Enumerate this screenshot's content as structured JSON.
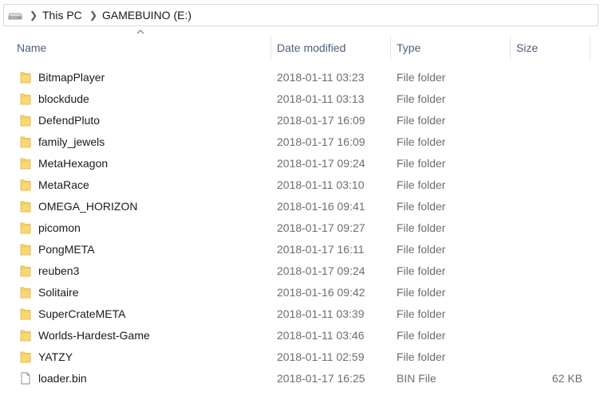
{
  "breadcrumb": {
    "items": [
      "This PC",
      "GAMEBUINO (E:)"
    ]
  },
  "columns": {
    "name": "Name",
    "date": "Date modified",
    "type": "Type",
    "size": "Size"
  },
  "files": [
    {
      "name": "BitmapPlayer",
      "date": "2018-01-11 03:23",
      "type": "File folder",
      "size": "",
      "icon": "folder-icon"
    },
    {
      "name": "blockdude",
      "date": "2018-01-11 03:13",
      "type": "File folder",
      "size": "",
      "icon": "folder-icon"
    },
    {
      "name": "DefendPluto",
      "date": "2018-01-17 16:09",
      "type": "File folder",
      "size": "",
      "icon": "folder-icon"
    },
    {
      "name": "family_jewels",
      "date": "2018-01-17 16:09",
      "type": "File folder",
      "size": "",
      "icon": "folder-icon"
    },
    {
      "name": "MetaHexagon",
      "date": "2018-01-17 09:24",
      "type": "File folder",
      "size": "",
      "icon": "folder-icon"
    },
    {
      "name": "MetaRace",
      "date": "2018-01-11 03:10",
      "type": "File folder",
      "size": "",
      "icon": "folder-icon"
    },
    {
      "name": "OMEGA_HORIZON",
      "date": "2018-01-16 09:41",
      "type": "File folder",
      "size": "",
      "icon": "folder-icon"
    },
    {
      "name": "picomon",
      "date": "2018-01-17 09:27",
      "type": "File folder",
      "size": "",
      "icon": "folder-icon"
    },
    {
      "name": "PongMETA",
      "date": "2018-01-17 16:11",
      "type": "File folder",
      "size": "",
      "icon": "folder-icon"
    },
    {
      "name": "reuben3",
      "date": "2018-01-17 09:24",
      "type": "File folder",
      "size": "",
      "icon": "folder-icon"
    },
    {
      "name": "Solitaire",
      "date": "2018-01-16 09:42",
      "type": "File folder",
      "size": "",
      "icon": "folder-icon"
    },
    {
      "name": "SuperCrateMETA",
      "date": "2018-01-11 03:39",
      "type": "File folder",
      "size": "",
      "icon": "folder-icon"
    },
    {
      "name": "Worlds-Hardest-Game",
      "date": "2018-01-11 03:46",
      "type": "File folder",
      "size": "",
      "icon": "folder-icon"
    },
    {
      "name": "YATZY",
      "date": "2018-01-11 02:59",
      "type": "File folder",
      "size": "",
      "icon": "folder-icon"
    },
    {
      "name": "loader.bin",
      "date": "2018-01-17 16:25",
      "type": "BIN File",
      "size": "62 KB",
      "icon": "file-icon"
    }
  ],
  "colors": {
    "folder": "#f8d775",
    "header_text": "#4c607a"
  }
}
